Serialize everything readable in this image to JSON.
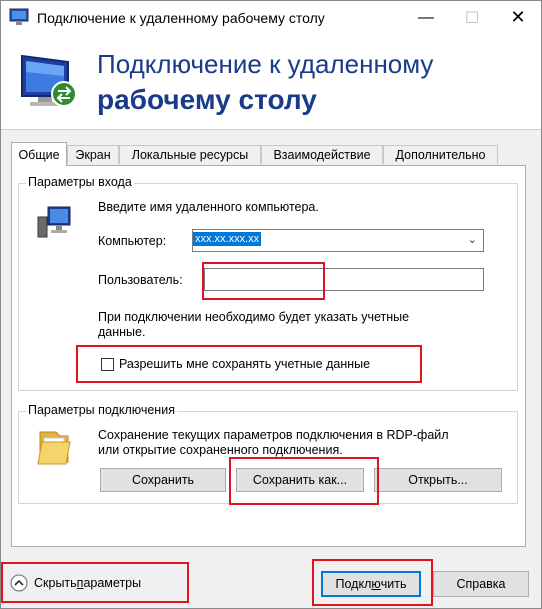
{
  "window": {
    "title": "Подключение к удаленному рабочему столу",
    "controls": {
      "minimize": "—",
      "maximize": "☐",
      "close": "✕"
    }
  },
  "banner": {
    "line1": "Подключение к удаленному",
    "line2": "рабочему столу"
  },
  "tabs": [
    {
      "label": "Общие",
      "active": true
    },
    {
      "label": "Экран"
    },
    {
      "label": "Локальные ресурсы"
    },
    {
      "label": "Взаимодействие"
    },
    {
      "label": "Дополнительно"
    }
  ],
  "login": {
    "group_title": "Параметры входа",
    "prompt": "Введите имя удаленного компьютера.",
    "computer_label": "Компьютер:",
    "computer_value": "xxx.xx.xxx.xx",
    "user_label": "Пользователь:",
    "user_value": "",
    "note_line1": "При подключении необходимо будет указать учетные",
    "note_line2": "данные.",
    "save_creds_label": "Разрешить мне сохранять учетные данные",
    "save_creds_checked": false
  },
  "connection": {
    "group_title": "Параметры подключения",
    "desc_line1": "Сохранение текущих параметров подключения в RDP-файл",
    "desc_line2": "или открытие сохраненного подключения.",
    "save_label": "Сохранить",
    "save_as_label": "Сохранить как...",
    "open_label": "Открыть..."
  },
  "footer": {
    "hide_prefix": "Скрыть ",
    "hide_underlined": "п",
    "hide_rest": "араметры",
    "connect_prefix": "Подкл",
    "connect_underlined": "ю",
    "connect_rest": "чить",
    "help_label": "Справка"
  },
  "colors": {
    "accent": "#0078d7",
    "banner_text": "#1a3a8a",
    "highlight_red": "#e0141e"
  },
  "icons": [
    "remote-desktop-icon",
    "computer-icon",
    "folder-icon",
    "chevron-up-icon",
    "chevron-down-icon"
  ]
}
